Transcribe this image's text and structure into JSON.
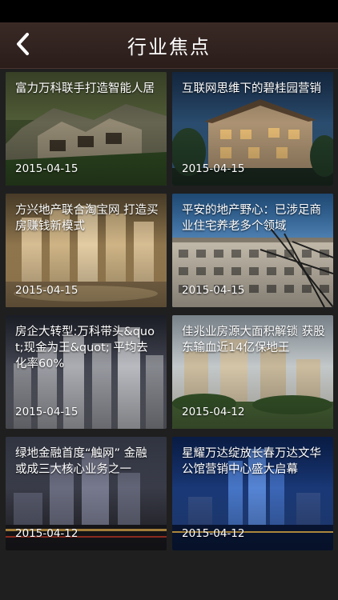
{
  "header": {
    "title": "行业焦点",
    "back_icon": "chevron-left-icon"
  },
  "colors": {
    "header_bg": "#2f211d",
    "page_bg": "#1f1f1f",
    "text": "#ffffff"
  },
  "articles": [
    {
      "title": "富力万科联手打造智能人居",
      "date": "2015-04-15"
    },
    {
      "title": "互联网思维下的碧桂园营销",
      "date": "2015-04-15"
    },
    {
      "title": "方兴地产联合淘宝网 打造买房赚钱新模式",
      "date": "2015-04-15"
    },
    {
      "title": "平安的地产野心：已涉足商业住宅养老多个领域",
      "date": "2015-04-15"
    },
    {
      "title": "房企大转型:万科带头&quot;现金为王&quot; 平均去化率60%",
      "date": "2015-04-15"
    },
    {
      "title": "佳兆业房源大面积解锁 获股东输血近14亿保地王",
      "date": "2015-04-12"
    },
    {
      "title": "绿地金融首度“触网” 金融或成三大核心业务之一",
      "date": "2015-04-12"
    },
    {
      "title": "星耀万达绽放长春万达文华公馆营销中心盛大启幕",
      "date": "2015-04-12"
    }
  ]
}
